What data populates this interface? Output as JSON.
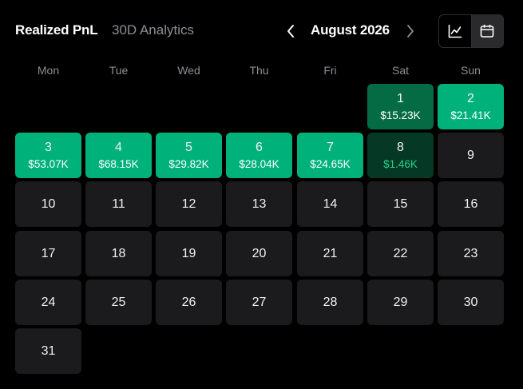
{
  "header": {
    "tab_active": "Realized PnL",
    "tab_inactive": "30D Analytics",
    "month": "August 2026",
    "prev_icon": "chevron-left-icon",
    "next_icon": "chevron-right-icon",
    "view_toggle": [
      {
        "icon": "line-chart-icon",
        "active": false
      },
      {
        "icon": "calendar-icon",
        "active": true
      }
    ]
  },
  "weekdays": [
    "Mon",
    "Tue",
    "Wed",
    "Thu",
    "Fri",
    "Sat",
    "Sun"
  ],
  "days": {
    "d1": {
      "day": "1",
      "pnl": "$15.23K",
      "tone": "mid"
    },
    "d2": {
      "day": "2",
      "pnl": "$21.41K",
      "tone": "strong"
    },
    "d3": {
      "day": "3",
      "pnl": "$53.07K",
      "tone": "strong"
    },
    "d4": {
      "day": "4",
      "pnl": "$68.15K",
      "tone": "strong"
    },
    "d5": {
      "day": "5",
      "pnl": "$29.82K",
      "tone": "strong"
    },
    "d6": {
      "day": "6",
      "pnl": "$28.04K",
      "tone": "strong"
    },
    "d7": {
      "day": "7",
      "pnl": "$24.65K",
      "tone": "strong"
    },
    "d8": {
      "day": "8",
      "pnl": "$1.46K",
      "tone": "weak"
    },
    "d9": {
      "day": "9"
    },
    "d10": {
      "day": "10"
    },
    "d11": {
      "day": "11"
    },
    "d12": {
      "day": "12"
    },
    "d13": {
      "day": "13"
    },
    "d14": {
      "day": "14"
    },
    "d15": {
      "day": "15"
    },
    "d16": {
      "day": "16"
    },
    "d17": {
      "day": "17"
    },
    "d18": {
      "day": "18"
    },
    "d19": {
      "day": "19"
    },
    "d20": {
      "day": "20"
    },
    "d21": {
      "day": "21"
    },
    "d22": {
      "day": "22"
    },
    "d23": {
      "day": "23"
    },
    "d24": {
      "day": "24"
    },
    "d25": {
      "day": "25"
    },
    "d26": {
      "day": "26"
    },
    "d27": {
      "day": "27"
    },
    "d28": {
      "day": "28"
    },
    "d29": {
      "day": "29"
    },
    "d30": {
      "day": "30"
    },
    "d31": {
      "day": "31"
    }
  },
  "colors": {
    "background": "#000000",
    "cell": "#1b1b1d",
    "profit_strong": "#00b27a",
    "profit_mid": "#056b45",
    "profit_weak": "#063826",
    "profit_text_weak": "#1fd38a",
    "muted_text": "#8e8e93"
  }
}
